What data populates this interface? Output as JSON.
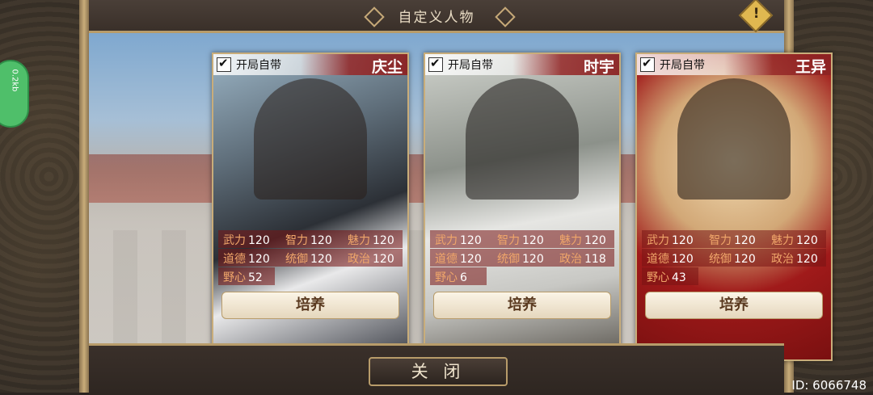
{
  "header": {
    "title": "自定义人物",
    "alert_icon": "!"
  },
  "side": {
    "tab_label": "0.2kb"
  },
  "cards": [
    {
      "checkbox_label": "开局自带",
      "name": "庆尘",
      "stats": {
        "武力": "120",
        "智力": "120",
        "魅力": "120",
        "道德": "120",
        "统御": "120",
        "政治": "120",
        "野心": "52"
      },
      "button_label": "培养"
    },
    {
      "checkbox_label": "开局自带",
      "name": "时宇",
      "stats": {
        "武力": "120",
        "智力": "120",
        "魅力": "120",
        "道德": "120",
        "统御": "120",
        "政治": "118",
        "野心": "6"
      },
      "button_label": "培养"
    },
    {
      "checkbox_label": "开局自带",
      "name": "王异",
      "stats": {
        "武力": "120",
        "智力": "120",
        "魅力": "120",
        "道德": "120",
        "统御": "120",
        "政治": "120",
        "野心": "43"
      },
      "button_label": "培养"
    }
  ],
  "stat_labels": {
    "wuli": "武力",
    "zhili": "智力",
    "meili": "魅力",
    "daode": "道德",
    "tongyu": "统御",
    "zhengzhi": "政治",
    "yexin": "野心"
  },
  "footer": {
    "close_label": "关 闭",
    "id_text": "ID:  6066748"
  }
}
